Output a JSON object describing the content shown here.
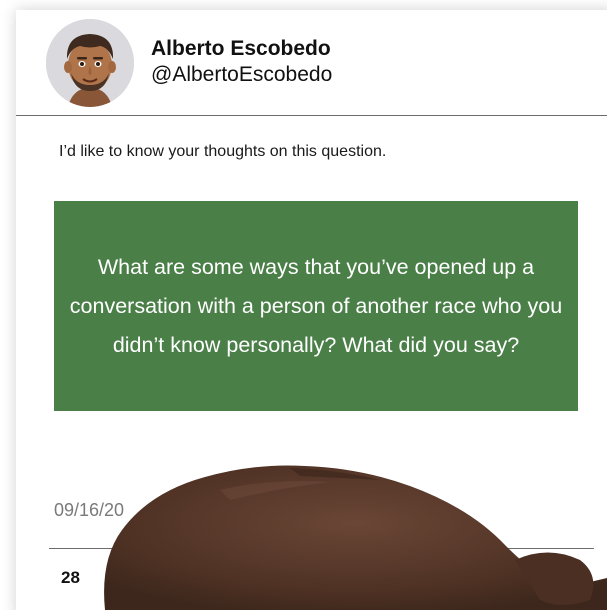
{
  "post": {
    "author_name": "Alberto Escobedo",
    "author_handle": "@AlbertoEscobedo",
    "message": "I’d like to know your thoughts on this question.",
    "question": "What are some ways that you’ve opened up a conversation with a person of another race who you didn’t know personally? What did you say?",
    "date": "09/16/20",
    "count": "28"
  },
  "colors": {
    "question_background": "#4a7f48",
    "question_text": "#ffffff",
    "date_text": "#7a7a7a"
  },
  "icons": {
    "avatar": "memoji-avatar",
    "overlay": "memoji-head-overlay"
  }
}
